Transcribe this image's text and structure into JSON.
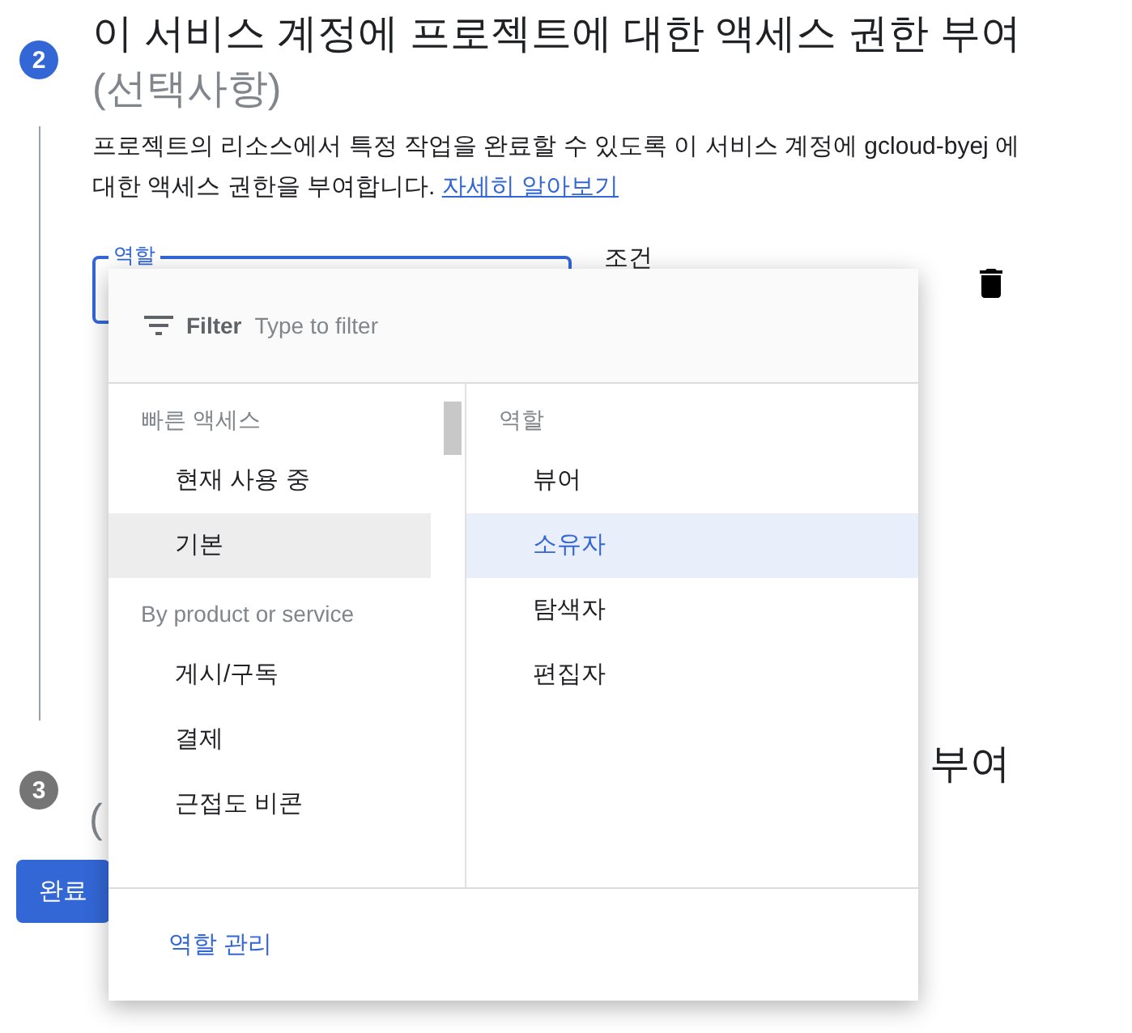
{
  "step2": {
    "number": "2",
    "title": "이 서비스 계정에 프로젝트에 대한 액세스 권한 부여",
    "subtitle": "(선택사항)",
    "description": "프로젝트의 리소스에서 특정 작업을 완료할 수 있도록 이 서비스 계정에 gcloud-byej 에 대한 액세스 권한을 부여합니다.",
    "link": "자세히 알아보기",
    "role_field": {
      "label": "역할"
    },
    "condition_label": "조건"
  },
  "step3": {
    "number": "3",
    "title_tail": "부여",
    "subtitle_head": "("
  },
  "done_button": "완료",
  "dropdown": {
    "filter_label": "Filter",
    "filter_placeholder": "Type to filter",
    "categories": [
      {
        "kind": "header",
        "label": "빠른 액세스"
      },
      {
        "kind": "item",
        "label": "현재 사용 중",
        "selected": false
      },
      {
        "kind": "item",
        "label": "기본",
        "selected": true
      },
      {
        "kind": "header",
        "label": "By product or service"
      },
      {
        "kind": "item",
        "label": "게시/구독",
        "selected": false
      },
      {
        "kind": "item",
        "label": "결제",
        "selected": false
      },
      {
        "kind": "item",
        "label": "근접도 비콘",
        "selected": false
      }
    ],
    "roles_header": "역할",
    "roles": [
      {
        "label": "뷰어",
        "selected": false
      },
      {
        "label": "소유자",
        "selected": true
      },
      {
        "label": "탐색자",
        "selected": false
      },
      {
        "label": "편집자",
        "selected": false
      }
    ],
    "footer_link": "역할 관리"
  }
}
